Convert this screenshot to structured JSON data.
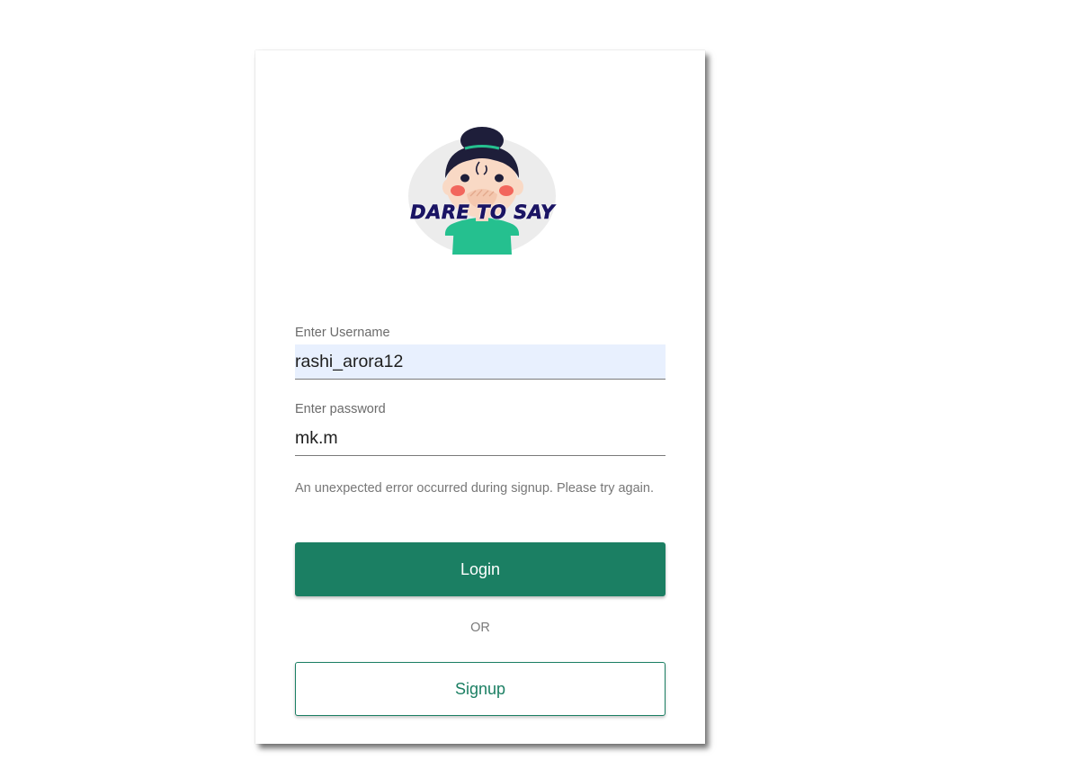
{
  "logo": {
    "text": "DARE TO SAY",
    "colors": {
      "background_circle": "#ececec",
      "hair": "#1e1e3a",
      "skin": "#f9d9c5",
      "cheeks": "#f2665c",
      "shirt": "#25c08f",
      "text": "#1a1464"
    }
  },
  "form": {
    "username": {
      "label": "Enter Username",
      "value": "rashi_arora12"
    },
    "password": {
      "label": "Enter password",
      "value": "mk.m"
    },
    "error_message": "An unexpected error occurred during signup. Please try again.",
    "login_label": "Login",
    "or_text": "OR",
    "signup_label": "Signup"
  },
  "colors": {
    "primary": "#1b7f63",
    "autofill_background": "#e8f0fe",
    "label": "#6b6b6b",
    "error_text": "#777777"
  }
}
